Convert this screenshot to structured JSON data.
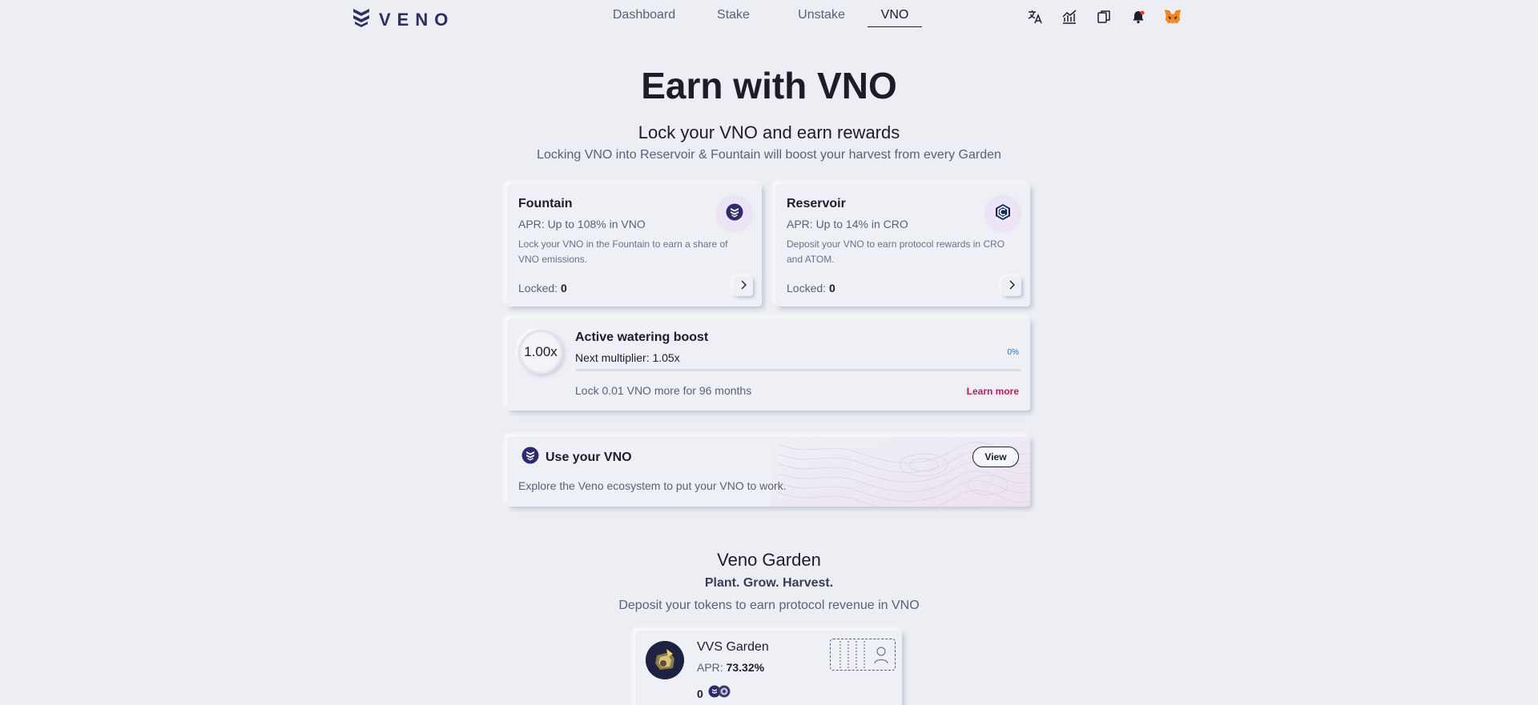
{
  "header": {
    "logo_text": "VENO",
    "nav": [
      {
        "label": "Dashboard"
      },
      {
        "label": "Stake"
      },
      {
        "label": "Unstake"
      },
      {
        "label": "VNO",
        "active": true
      }
    ],
    "icons": [
      "translate-icon",
      "chart-icon",
      "copy-icon",
      "notification-bell-icon",
      "metamask-fox-icon"
    ]
  },
  "hero": {
    "title": "Earn with VNO",
    "subtitle": "Lock your VNO and earn rewards",
    "description": "Locking VNO into Reservoir & Fountain will boost your harvest from every Garden"
  },
  "fountain": {
    "title": "Fountain",
    "apr": "APR: Up to 108% in VNO",
    "description": "Lock your VNO in the Fountain to earn a share of VNO emissions.",
    "locked_label": "Locked:",
    "locked_value": "0"
  },
  "reservoir": {
    "title": "Reservoir",
    "apr": "APR: Up to 14% in CRO",
    "description": "Deposit your VNO to earn protocol rewards in CRO and ATOM.",
    "locked_label": "Locked:",
    "locked_value": "0"
  },
  "boost": {
    "multiplier": "1.00x",
    "title": "Active watering boost",
    "next_multiplier": "Next multiplier: 1.05x",
    "percent": "0%",
    "progress": 0,
    "lock_hint": "Lock 0.01 VNO more for 96 months",
    "learn_more": "Learn more"
  },
  "use_vno": {
    "title": "Use your VNO",
    "view_label": "View",
    "description": "Explore the Veno ecosystem to put your VNO to work."
  },
  "garden": {
    "title": "Veno Garden",
    "tagline": "Plant. Grow. Harvest.",
    "description": "Deposit your tokens to earn protocol revenue in VNO",
    "item": {
      "name": "VVS Garden",
      "apr_label": "APR:",
      "apr_value": "73.32%",
      "amount": "0"
    }
  },
  "colors": {
    "background": "#eceef3",
    "accent": "#2c2f5f",
    "learn_more": "#c2185b",
    "percent": "#2a6db5"
  }
}
